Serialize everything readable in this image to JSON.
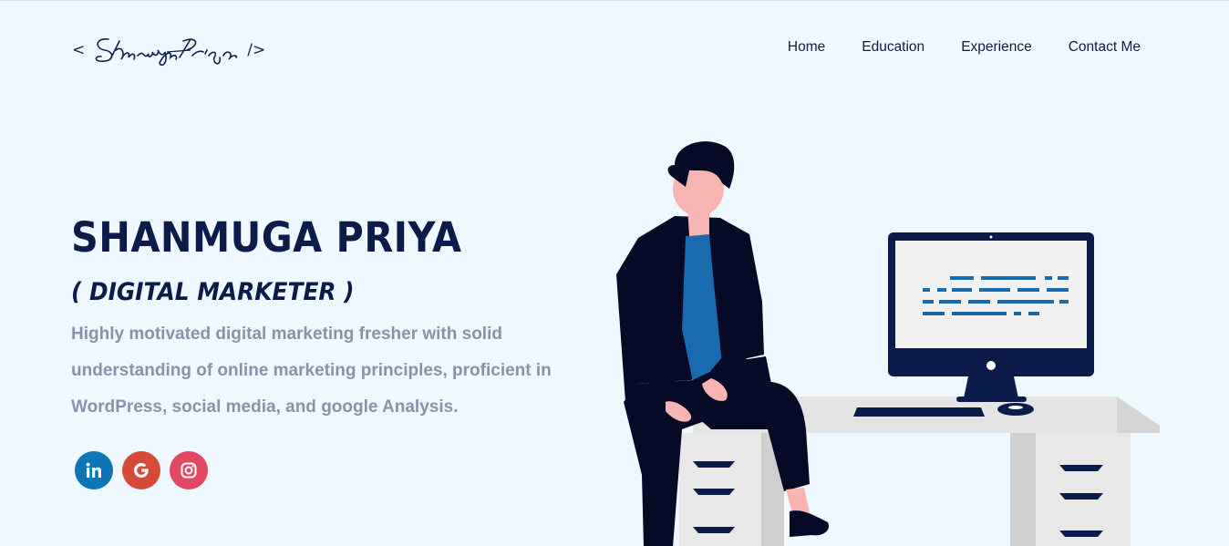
{
  "header": {
    "logo": {
      "open": "<",
      "close": "/>",
      "signature": "Shanmuga Priya"
    },
    "nav": [
      "Home",
      "Education",
      "Experience",
      "Contact Me"
    ]
  },
  "hero": {
    "name": "SHANMUGA PRIYA",
    "role": "( DIGITAL MARKETER )",
    "description": "Highly motivated digital marketing fresher with solid understanding of online marketing principles, proficient in WordPress, social media, and google Analysis."
  },
  "socials": [
    {
      "icon": "linkedin-icon",
      "color": "#0f76b5"
    },
    {
      "icon": "google-icon",
      "color": "#d64a39"
    },
    {
      "icon": "instagram-icon",
      "color": "#e14863"
    }
  ],
  "colors": {
    "background": "#eef8fe",
    "primary": "#0b1c4b",
    "muted": "#8893a9"
  }
}
